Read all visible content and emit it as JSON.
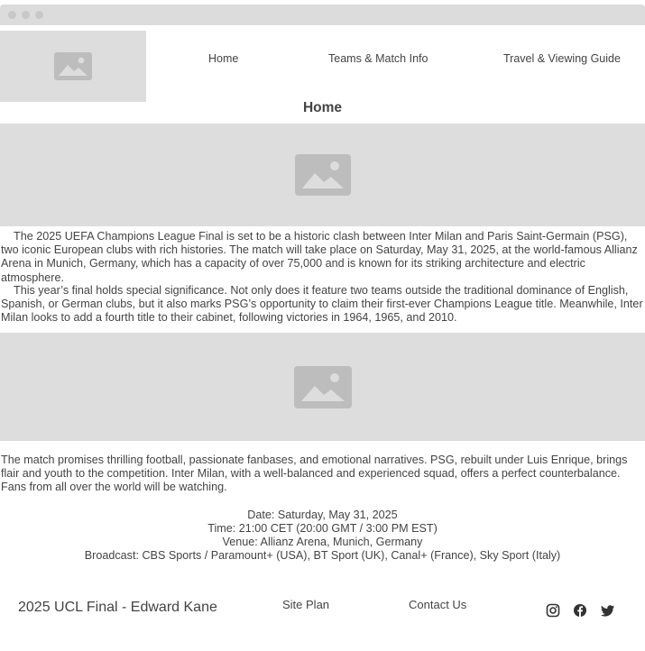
{
  "nav": {
    "logo_icon": "image-placeholder-icon",
    "links": [
      "Home",
      "Teams & Match Info",
      "Travel & Viewing Guide"
    ]
  },
  "page": {
    "title": "Home"
  },
  "content": {
    "hero_image_icon": "image-placeholder-icon",
    "paragraph1": "The 2025 UEFA Champions League Final is set to be a historic clash between Inter Milan and Paris Saint-Germain (PSG), two iconic European clubs with rich histories. The match will take place on Saturday, May 31, 2025, at the world-famous Allianz Arena in Munich, Germany, which has a capacity of over 75,000 and is known for its striking architecture and electric atmosphere.",
    "paragraph2": "This year’s final holds special significance. Not only does it feature two teams outside the traditional dominance of English, Spanish, or German clubs, but it also marks PSG’s opportunity to claim their first-ever Champions League title. Meanwhile, Inter Milan looks to add a fourth title to their cabinet, following victories in 1964, 1965, and 2010.",
    "second_image_icon": "image-placeholder-icon",
    "paragraph3": "The match promises thrilling football, passionate fanbases, and emotional narratives. PSG, rebuilt under Luis Enrique, brings flair and youth to the competition. Inter Milan, with a well-balanced and experienced squad, offers a perfect counterbalance. Fans from all over the world will be watching."
  },
  "match_info": {
    "date": "Date: Saturday, May 31, 2025",
    "time": "Time: 21:00 CET (20:00 GMT / 3:00 PM EST)",
    "venue": "Venue: Allianz Arena, Munich, Germany",
    "broadcast": "Broadcast: CBS Sports / Paramount+ (USA), BT Sport (UK), Canal+ (France), Sky Sport (Italy)"
  },
  "footer": {
    "title": "2025 UCL Final - Edward Kane",
    "links": [
      "Site Plan",
      "Contact Us"
    ],
    "social_icons": [
      "instagram-icon",
      "facebook-icon",
      "twitter-icon"
    ]
  },
  "colors": {
    "placeholder_bg": "#dddddd",
    "placeholder_icon": "#bdbdbd",
    "text": "#444444"
  }
}
